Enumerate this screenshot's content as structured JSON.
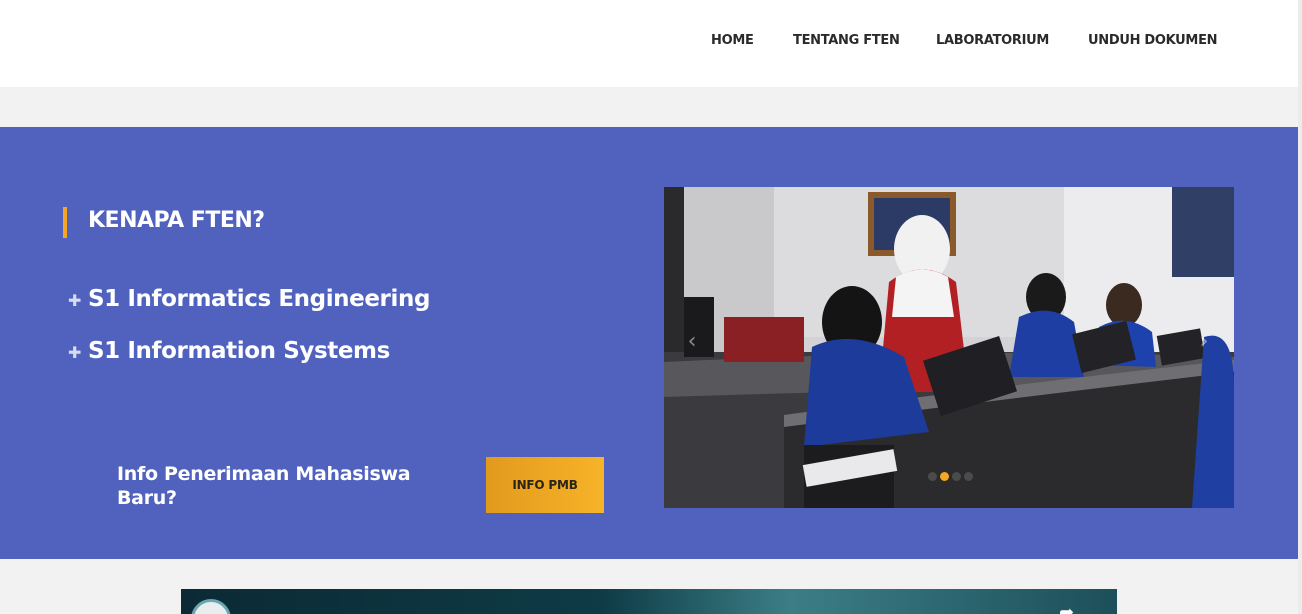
{
  "nav": {
    "items": [
      {
        "label": "HOME"
      },
      {
        "label": "TENTANG FTEN"
      },
      {
        "label": "LABORATORIUM"
      },
      {
        "label": "UNDUH DOKUMEN"
      }
    ]
  },
  "hero": {
    "title": "KENAPA FTEN?",
    "programs": [
      {
        "label": "S1 Informatics Engineering",
        "icon": "plus-icon"
      },
      {
        "label": "S1 Information Systems",
        "icon": "plus-icon"
      }
    ],
    "pmb_question": "Info Penerimaan Mahasiswa Baru?",
    "pmb_button": "INFO PMB"
  },
  "slider": {
    "slide_count": 4,
    "active_index": 1
  },
  "colors": {
    "hero_bg": "#5062bd",
    "accent": "#f6a623",
    "header_bg": "#ffffff",
    "page_bg": "#f3f2f3"
  }
}
